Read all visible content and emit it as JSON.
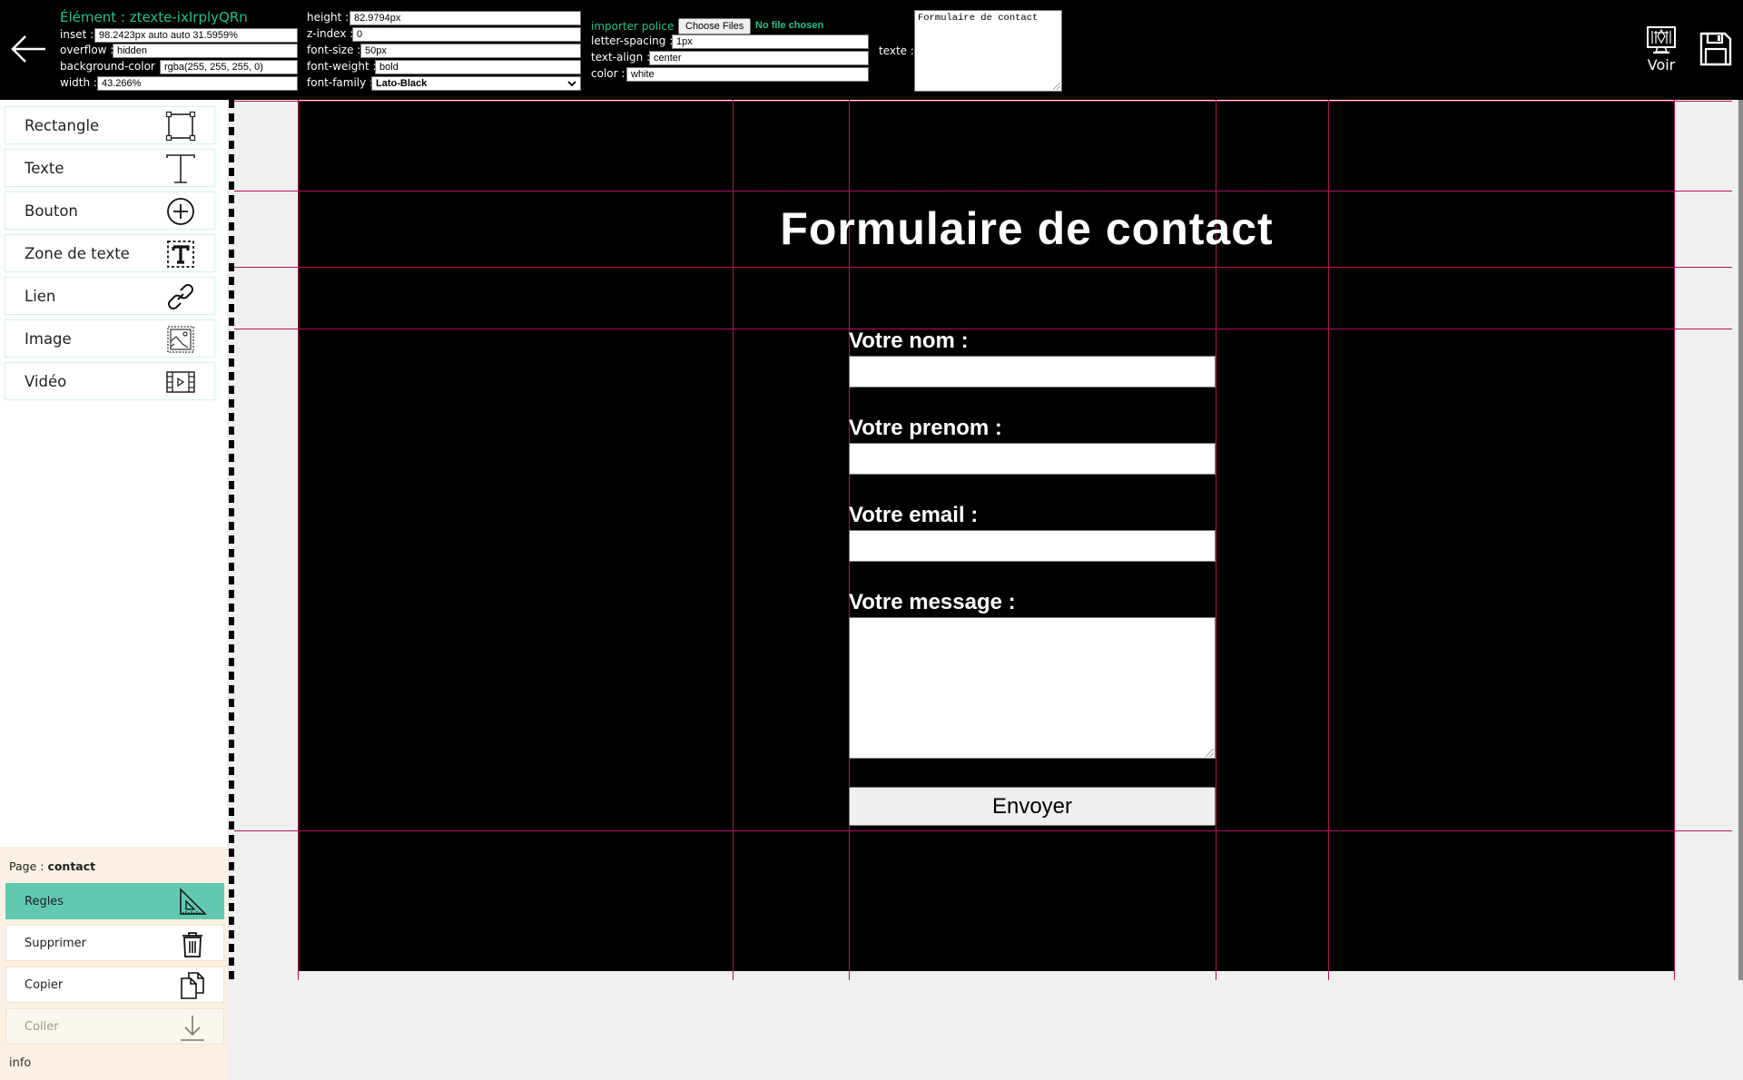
{
  "topbar": {
    "element_title": "Élément : ztexte-ixIrplyQRn",
    "props_col1": [
      {
        "label": "inset :",
        "value": "98.2423px auto auto 31.5959%"
      },
      {
        "label": "overflow :",
        "value": "hidden"
      },
      {
        "label": "background-color :",
        "value": "rgba(255, 255, 255, 0)"
      },
      {
        "label": "width :",
        "value": "43.266%"
      }
    ],
    "props_col2": [
      {
        "label": "height :",
        "value": "82.9794px"
      },
      {
        "label": "z-index :",
        "value": "0"
      },
      {
        "label": "font-size :",
        "value": "50px"
      },
      {
        "label": "font-weight :",
        "value": "bold"
      },
      {
        "label": "font-family :",
        "value": "Lato-Black"
      }
    ],
    "font_import": {
      "label": "importer police :",
      "button": "Choose Files",
      "status": "No file chosen"
    },
    "props_col3": [
      {
        "label": "letter-spacing :",
        "value": "1px"
      },
      {
        "label": "text-align :",
        "value": "center"
      },
      {
        "label": "color :",
        "value": "white"
      }
    ],
    "texte": {
      "label": "texte :",
      "value": "Formulaire de contact"
    },
    "voir_label": "Voir",
    "accent_color": "#1fc38a"
  },
  "tools": [
    {
      "label": "Rectangle",
      "icon": "rectangle-icon"
    },
    {
      "label": "Texte",
      "icon": "text-icon"
    },
    {
      "label": "Bouton",
      "icon": "plus-circle-icon"
    },
    {
      "label": "Zone de texte",
      "icon": "textbox-icon"
    },
    {
      "label": "Lien",
      "icon": "link-icon"
    },
    {
      "label": "Image",
      "icon": "image-icon"
    },
    {
      "label": "Vidéo",
      "icon": "video-icon"
    }
  ],
  "page_panel": {
    "page_label": "Page :",
    "page_name": "contact",
    "actions": [
      {
        "label": "Regles",
        "icon": "ruler-triangle-icon",
        "state": "active"
      },
      {
        "label": "Supprimer",
        "icon": "trash-icon",
        "state": "normal"
      },
      {
        "label": "Copier",
        "icon": "copy-icon",
        "state": "normal"
      },
      {
        "label": "Coller",
        "icon": "paste-download-icon",
        "state": "disabled"
      }
    ],
    "info_label": "info",
    "active_color": "#62c9b1"
  },
  "canvas": {
    "title": "Formulaire de contact",
    "fields": [
      {
        "label": "Votre nom :",
        "value": ""
      },
      {
        "label": "Votre prenom :",
        "value": ""
      },
      {
        "label": "Votre email :",
        "value": ""
      },
      {
        "label": "Votre message :",
        "value": ""
      }
    ],
    "submit_label": "Envoyer",
    "guide_color": "#b0145a"
  }
}
